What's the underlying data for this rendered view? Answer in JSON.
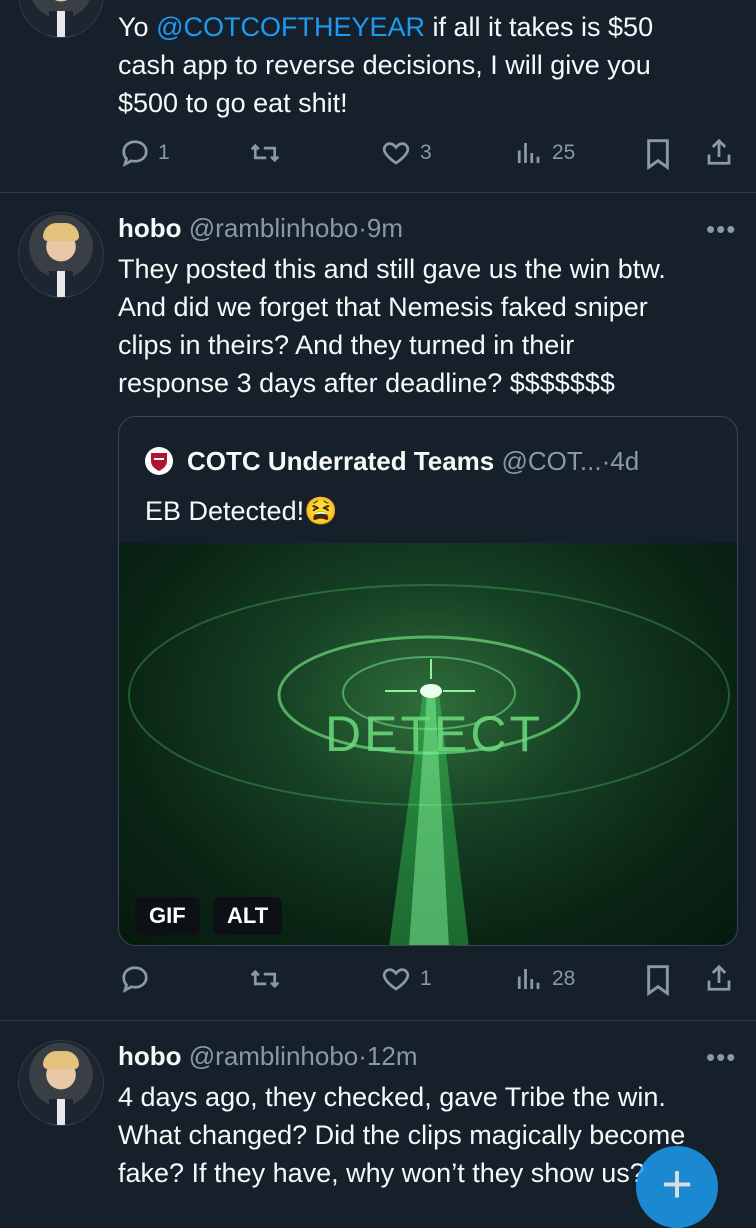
{
  "tweet1": {
    "text_parts": [
      "Yo ",
      "@COTCOFTHEYEAR",
      " if all it takes is $50",
      "cash app to reverse decisions, I will give you",
      "$500 to go eat shit!"
    ],
    "reply_count": "1",
    "like_count": "3",
    "view_count": "25"
  },
  "tweet2": {
    "name": "hobo",
    "handle": "@ramblinhobo",
    "time": "9m",
    "lines": [
      "They posted this and still gave us the win btw.",
      "And did we forget that Nemesis faked sniper",
      "clips in theirs? And they turned in their",
      "response 3 days after deadline? $$$$$$$"
    ],
    "quote": {
      "name": "COTC Underrated Teams",
      "handle": "@COT...",
      "time": "4d",
      "text": "EB Detected!",
      "emoji": "😫",
      "media_text": "DETECT",
      "badge_gif": "GIF",
      "badge_alt": "ALT"
    },
    "reply_count": "",
    "like_count": "1",
    "view_count": "28"
  },
  "tweet3": {
    "name": "hobo",
    "handle": "@ramblinhobo",
    "time": "12m",
    "lines": [
      "4 days ago, they checked, gave Tribe the win.",
      "What changed? Did the clips magically become",
      "fake? If they have, why won’t they show us?"
    ]
  },
  "ui": {
    "more_label": "•••",
    "separator": "·",
    "fab_label": "+"
  },
  "colors": {
    "background": "#15202b",
    "accent": "#1d9bf0",
    "muted": "#8b98a5"
  }
}
